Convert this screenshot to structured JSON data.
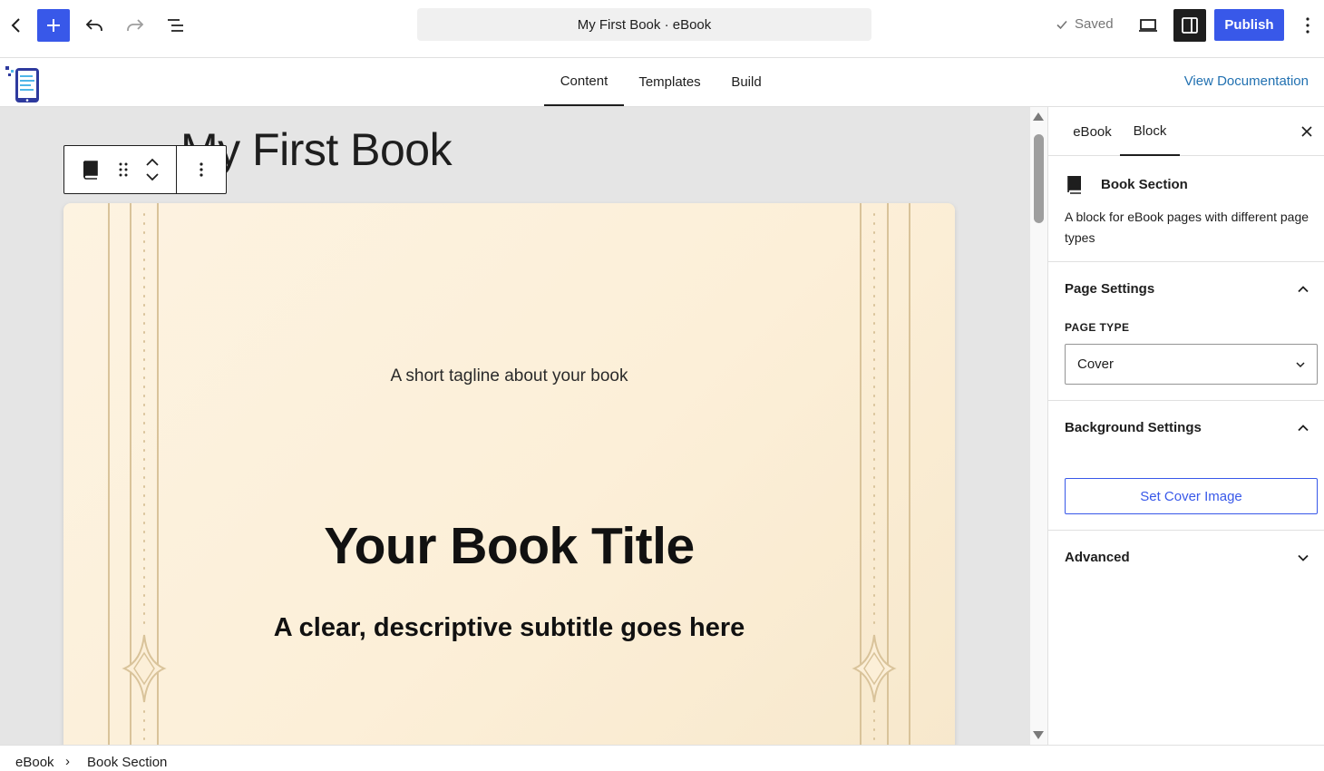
{
  "topbar": {
    "document_title": "My First Book · eBook",
    "saved_label": "Saved",
    "publish_label": "Publish"
  },
  "navbar": {
    "tabs": [
      {
        "label": "Content",
        "active": true
      },
      {
        "label": "Templates",
        "active": false
      },
      {
        "label": "Build",
        "active": false
      }
    ],
    "view_documentation": "View Documentation"
  },
  "canvas": {
    "doc_title": "My First Book",
    "page": {
      "tagline": "A short tagline about your book",
      "title": "Your Book Title",
      "subtitle": "A clear, descriptive subtitle goes here"
    }
  },
  "sidebar": {
    "tabs": [
      {
        "label": "eBook",
        "active": false
      },
      {
        "label": "Block",
        "active": true
      }
    ],
    "block": {
      "name": "Book Section",
      "description": "A block for eBook pages with different page types"
    },
    "page_settings": {
      "title": "Page Settings",
      "page_type_label": "PAGE TYPE",
      "page_type_value": "Cover"
    },
    "background_settings": {
      "title": "Background Settings",
      "set_cover_image": "Set Cover Image"
    },
    "advanced": {
      "title": "Advanced"
    }
  },
  "breadcrumb": {
    "items": [
      "eBook",
      "Book Section"
    ],
    "separator": "›"
  },
  "colors": {
    "accent": "#3858e9",
    "link": "#2271b1",
    "page_bg": "#fdf3e1",
    "ornament": "#d9c39a",
    "canvas_bg": "#e5e5e5"
  }
}
